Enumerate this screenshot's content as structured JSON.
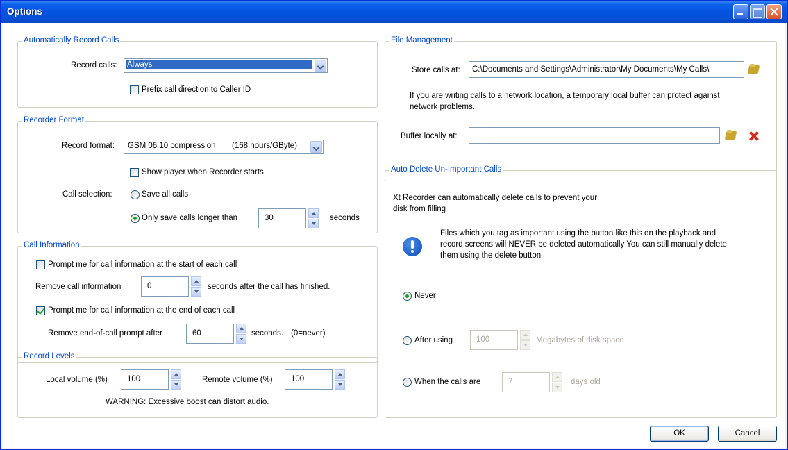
{
  "window": {
    "title": "Options"
  },
  "auto_record": {
    "legend": "Automatically Record Calls",
    "record_calls_label": "Record calls:",
    "record_calls_value": "Always",
    "prefix_label": "Prefix call direction to Caller ID",
    "prefix_checked": false
  },
  "recorder_format": {
    "legend": "Recorder Format",
    "record_format_label": "Record format:",
    "record_format_value": "GSM 06.10 compression",
    "record_format_rate": "(168 hours/GByte)",
    "show_player_label": "Show player when Recorder starts",
    "show_player_checked": false,
    "call_selection_label": "Call selection:",
    "save_all_label": "Save all calls",
    "only_longer_label": "Only save calls longer than",
    "seconds_value": "30",
    "seconds_label": "seconds"
  },
  "call_info": {
    "legend": "Call Information",
    "prompt_start_label": "Prompt me for call information at the start of each call",
    "prompt_start_checked": false,
    "remove_info_label": "Remove call information",
    "remove_info_value": "0",
    "remove_info_suffix": "seconds after the call has finished.",
    "prompt_end_label": "Prompt me for call information at the end of each call",
    "prompt_end_checked": true,
    "remove_prompt_label": "Remove end-of-call prompt after",
    "remove_prompt_value": "60",
    "remove_prompt_suffix": "seconds.",
    "remove_prompt_note": "(0=never)"
  },
  "record_levels": {
    "legend": "Record Levels",
    "local_label": "Local volume (%)",
    "local_value": "100",
    "remote_label": "Remote volume (%)",
    "remote_value": "100",
    "warning": "WARNING: Excessive boost can distort audio."
  },
  "file_management": {
    "legend": "File Management",
    "store_label": "Store calls at:",
    "store_value": "C:\\Documents and Settings\\Administrator\\My Documents\\My Calls\\",
    "buffer_info_line1": "If you are writing calls to a network location, a temporary local buffer can protect against",
    "buffer_info_line2": "network problems.",
    "buffer_label": "Buffer locally at:",
    "buffer_value": ""
  },
  "auto_delete": {
    "legend": "Auto Delete Un-Important Calls",
    "intro_line1": "Xt Recorder can automatically delete calls to prevent your",
    "intro_line2": "disk from filling",
    "note_line1": "Files which you tag as important using the button like this on the playback and",
    "note_line2": "record screens will NEVER be deleted automatically You can still manually delete",
    "note_line3": "them using the delete button",
    "never_label": "Never",
    "after_using_label": "After using",
    "after_using_value": "100",
    "after_using_suffix": "Megabytes of disk space",
    "when_calls_label": "When the calls are",
    "when_calls_value": "7",
    "when_calls_suffix": "days old",
    "selected": "Never"
  },
  "buttons": {
    "ok": "OK",
    "cancel": "Cancel"
  },
  "icons": [
    "folder-icon",
    "delete-x-icon",
    "info-icon",
    "minimize-icon",
    "maximize-icon",
    "close-icon"
  ],
  "colors": {
    "titlebar": "#0554e0",
    "legend_text": "#0046d5",
    "selection": "#316ac5"
  }
}
